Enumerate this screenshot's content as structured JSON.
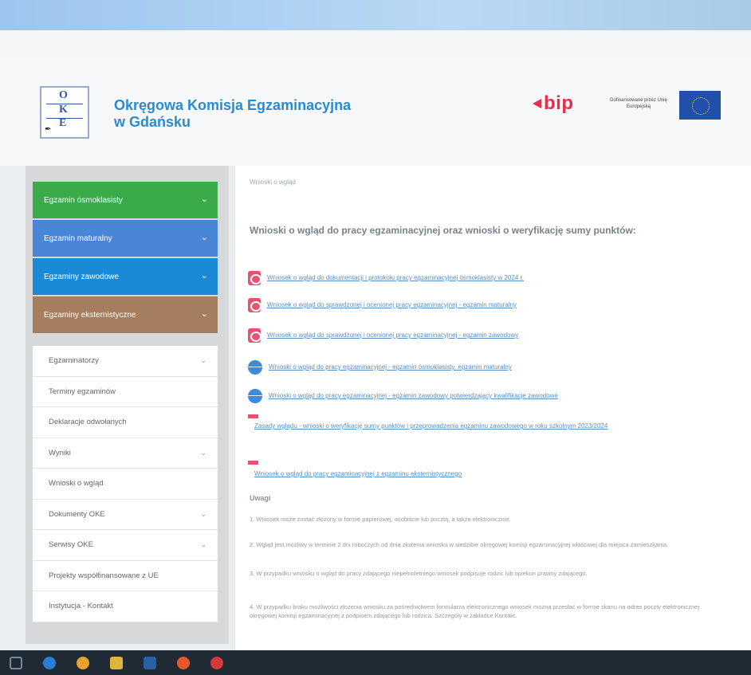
{
  "header": {
    "org_name_line1": "Okręgowa Komisja Egzaminacyjna",
    "org_name_line2": "w Gdańsku",
    "logo": {
      "letters": [
        "O",
        "K",
        "E"
      ]
    },
    "bip_label": "bip",
    "eu_text": "Dofinansowane przez Unię Europejską"
  },
  "sidebar": {
    "exam_buttons": [
      {
        "label": "Egzamin ósmoklasisty",
        "color": "#3aaa4b"
      },
      {
        "label": "Egzamin maturalny",
        "color": "#4a86d8"
      },
      {
        "label": "Egzaminy zawodowe",
        "color": "#1a8ad6"
      },
      {
        "label": "Egzaminy eksternistyczne",
        "color": "#a57f5d"
      }
    ],
    "menu_items": [
      {
        "label": "Egzaminatorzy",
        "has_chevron": true
      },
      {
        "label": "Terminy egzaminów",
        "has_chevron": false
      },
      {
        "label": "Deklaracje odwołanych",
        "has_chevron": false
      },
      {
        "label": "Wyniki",
        "has_chevron": true
      },
      {
        "label": "Wnioski o wgląd",
        "has_chevron": false
      },
      {
        "label": "Dokumenty OKE",
        "has_chevron": true
      },
      {
        "label": "Serwisy OKE",
        "has_chevron": true
      },
      {
        "label": "Projekty współfinansowane z UE",
        "has_chevron": false
      },
      {
        "label": "Instytucja - Kontakt",
        "has_chevron": false
      }
    ]
  },
  "content": {
    "breadcrumb": "Wnioski o wgląd",
    "heading": "Wnioski o wgląd do pracy egzaminacyjnej oraz wnioski o weryfikację sumy punktów:",
    "docs": [
      {
        "icon": "pdf-icon",
        "text": "Wniosek o wgląd do dokumentacji i protokołu pracy egzaminacyjnej ósmoklasisty w 2024 r."
      },
      {
        "icon": "pdf-icon",
        "text": "Wniosek o wgląd do sprawdzonej i ocenionej pracy egzaminacyjnej - egzamin maturalny"
      },
      {
        "icon": "pdf-icon",
        "text": "Wniosek o wgląd do sprawdzonej i ocenionej pracy egzaminacyjnej - egzamin zawodowy"
      },
      {
        "icon": "globe-icon",
        "text": "Wnioski o wgląd do pracy egzaminacyjnej - egzamin ósmoklasisty, egzamin maturalny"
      },
      {
        "icon": "globe-icon",
        "text": "Wnioski o wgląd do pracy egzaminacyjnej - egzamin zawodowy potwierdzający kwalifikacje zawodowe"
      },
      {
        "icon": "pdf-small-icon",
        "text": "Zasady wglądu - wnioski o weryfikację sumy punktów i przeprowadzenia egzaminu zawodowego w roku szkolnym 2023/2024"
      },
      {
        "icon": "pdf-small-icon",
        "text": "Wniosek o wgląd do pracy egzaminacyjnej z egzaminu eksternistycznego"
      }
    ],
    "notes_title": "Uwagi",
    "notes": [
      "1. Wniosek może zostać złożony w formie papierowej, osobiście lub pocztą, a także elektronicznie.",
      "2. Wgląd jest możliwy w terminie 2 dni roboczych od dnia złożenia wniosku w siedzibie okręgowej komisji egzaminacyjnej właściwej dla miejsca zamieszkania.",
      "3. W przypadku wniosku o wgląd do pracy zdającego niepełnoletniego wniosek podpisuje rodzic lub opiekun prawny zdającego.",
      "4. W przypadku braku możliwości złożenia wniosku za pośrednictwem formularza elektronicznego wniosek można przesłać w formie skanu na adres poczty elektronicznej okręgowej komisji egzaminacyjnej z podpisem zdającego lub rodzica. Szczegóły w zakładce Kontakt."
    ]
  }
}
